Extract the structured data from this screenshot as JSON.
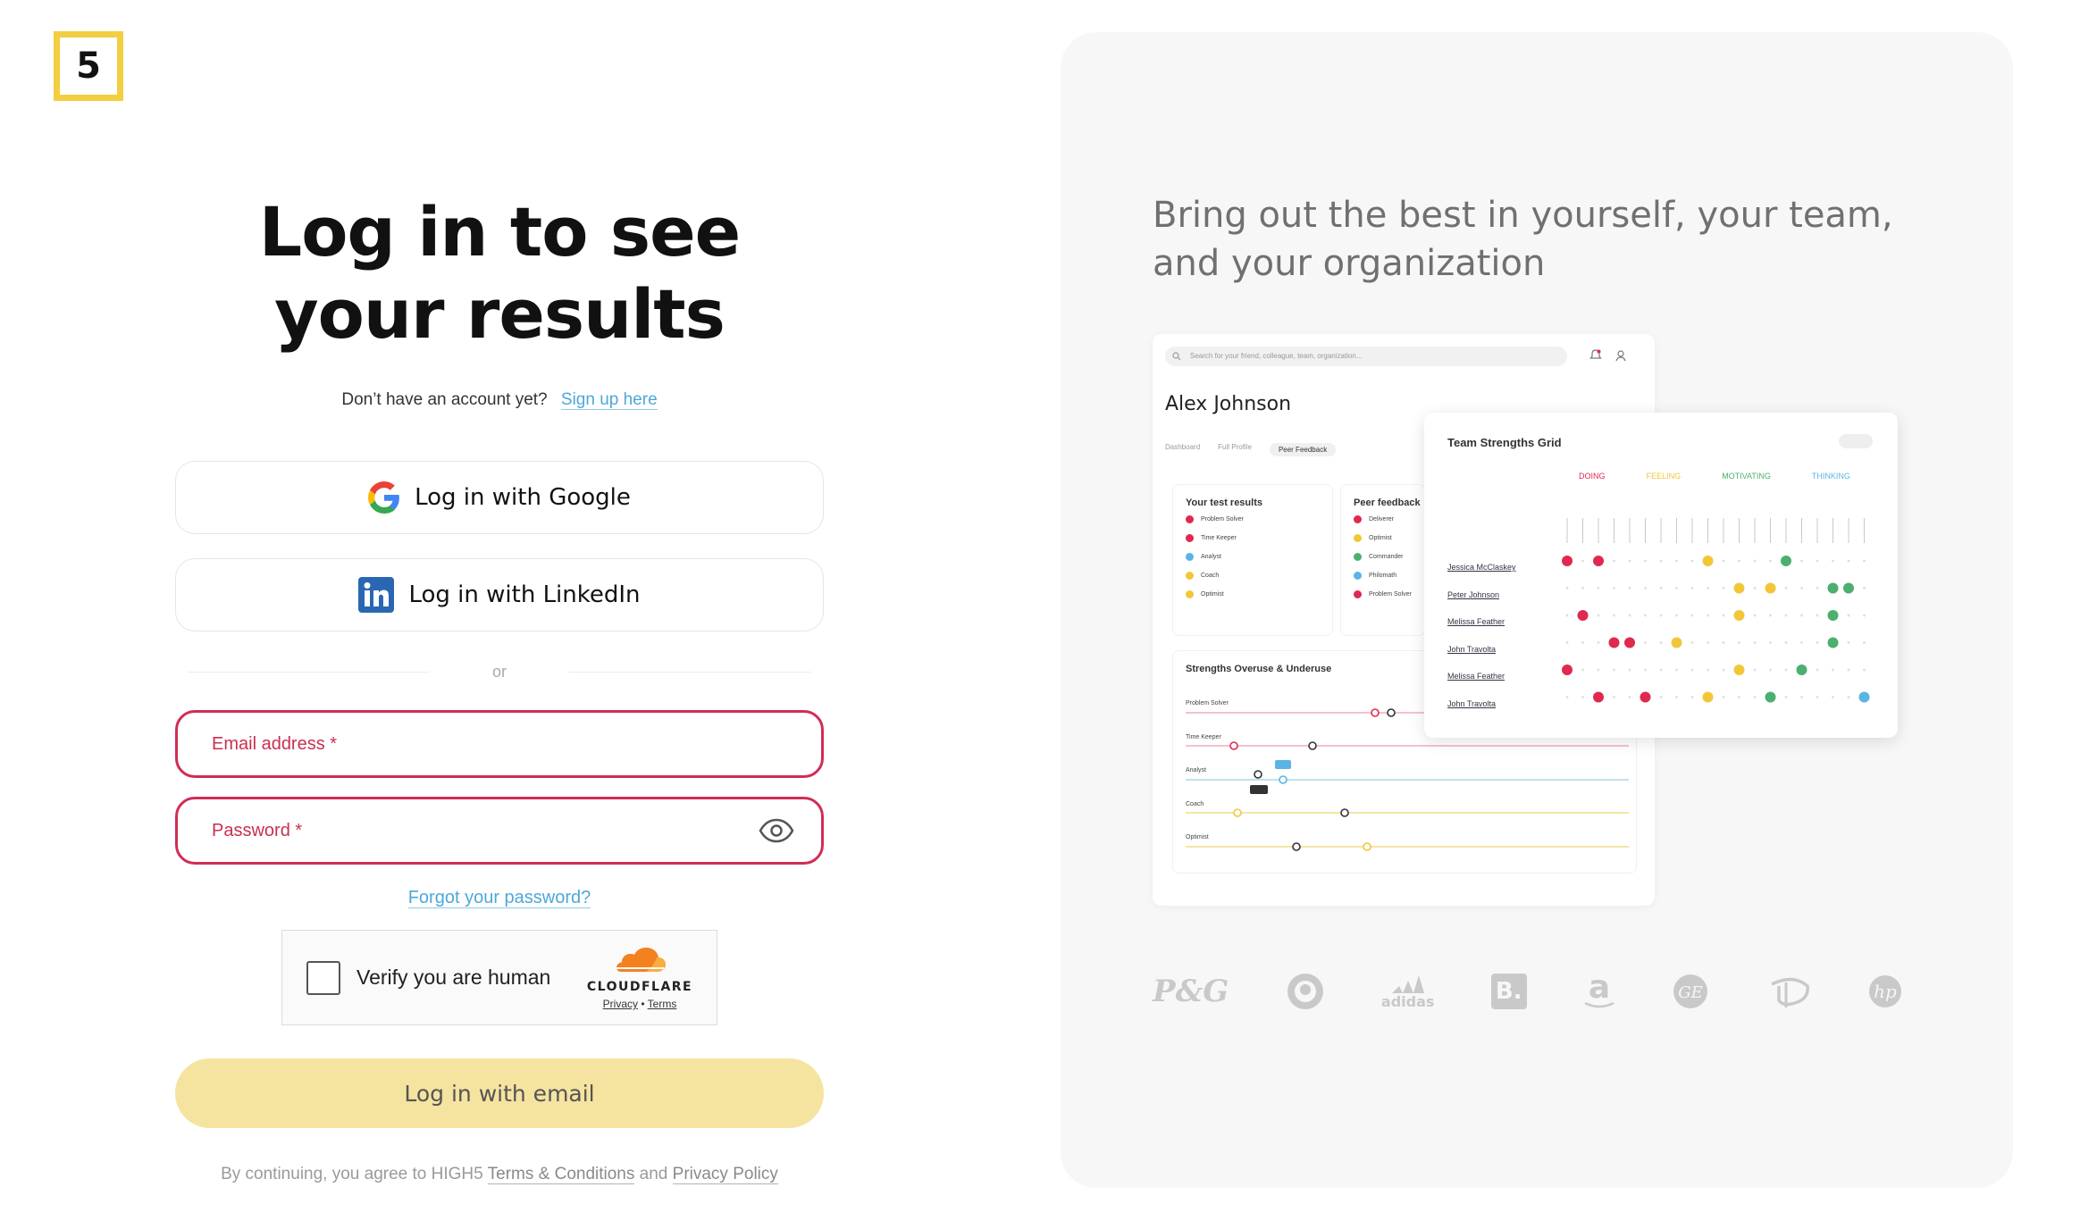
{
  "brand": {
    "logo_text": "5",
    "logo_color": "#F3CE40"
  },
  "login": {
    "title": "Log in to see your results",
    "signup_prompt": "Don’t have an account yet?",
    "signup_link": "Sign up here",
    "google_label": "Log in with Google",
    "linkedin_label": "Log in with LinkedIn",
    "divider_text": "or",
    "email_placeholder": "Email address *",
    "password_placeholder": "Password *",
    "forgot_link": "Forgot your password?",
    "captcha": {
      "label": "Verify you are human",
      "provider": "CLOUDFLARE",
      "privacy": "Privacy",
      "separator": "•",
      "terms": "Terms"
    },
    "email_button": "Log in with email",
    "legal_prefix": "By continuing, you agree to HIGH5",
    "legal_terms": "Terms & Conditions",
    "legal_and": "and",
    "legal_privacy": "Privacy Policy"
  },
  "promo": {
    "tagline": "Bring out the best in yourself, your team, and your organization",
    "mock": {
      "search_placeholder": "Search for your friend, colleague, team, organization...",
      "profile_name": "Alex Johnson",
      "tabs": [
        "Dashboard",
        "Full Profile",
        "Peer Feedback"
      ],
      "results_title": "Your test results",
      "results": [
        "Problem Solver",
        "Time Keeper",
        "Analyst",
        "Coach",
        "Optimist"
      ],
      "peer_title": "Peer feedback",
      "peer": [
        "Deliverer",
        "Optimist",
        "Commander",
        "Philomath",
        "Problem Solver"
      ],
      "strengths_title": "Strengths Overuse & Underuse",
      "strengths_rows": [
        "Problem Solver",
        "Time Keeper",
        "Analyst",
        "Coach",
        "Optimist"
      ],
      "grid_title": "Team Strengths Grid",
      "grid_groups": [
        "DOING",
        "FEELING",
        "MOTIVATING",
        "THINKING"
      ],
      "grid_people": [
        "Jessica McClaskey",
        "Peter Johnson",
        "Melissa Feather",
        "John Travolta",
        "Melissa Feather",
        "John Travolta"
      ]
    },
    "customer_logos": [
      "P&G",
      "Starbucks",
      "adidas",
      "Booking",
      "amazon",
      "GE",
      "Disney",
      "hp"
    ]
  },
  "colors": {
    "error_red": "#D22C55",
    "link_blue": "#4DA8D8",
    "email_button_bg": "#F5E3A0",
    "doing": "#E0294F",
    "feeling": "#F2C737",
    "motivating": "#4CAF6E",
    "thinking": "#5AB4E5"
  }
}
